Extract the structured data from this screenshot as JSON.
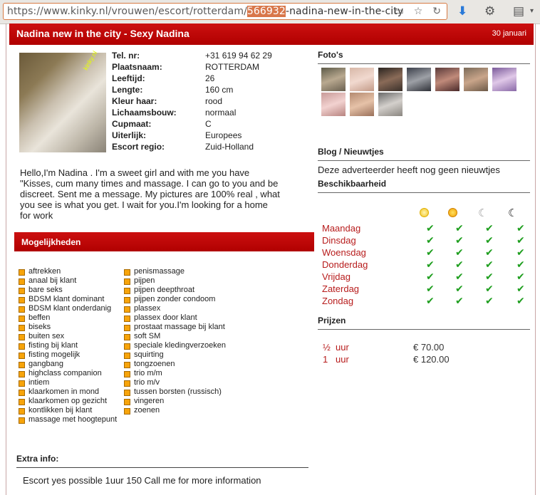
{
  "browser": {
    "url_prefix": "https://www.kinky.nl/vrouwen/escort/rotterdam/",
    "url_highlight": "566932",
    "url_suffix": "-nadina-new-in-the-city"
  },
  "header": {
    "title": "Nadina new in the city - Sexy Nadina",
    "date": "30 januari"
  },
  "profile": {
    "photo_logo": "kinky.nl",
    "fields": [
      {
        "label": "Tel. nr:",
        "value": "+31 619 94 62 29"
      },
      {
        "label": "Plaatsnaam:",
        "value": "ROTTERDAM"
      },
      {
        "label": "Leeftijd:",
        "value": "26"
      },
      {
        "label": "Lengte:",
        "value": "160 cm"
      },
      {
        "label": "Kleur haar:",
        "value": "rood"
      },
      {
        "label": "Lichaamsbouw:",
        "value": "normaal"
      },
      {
        "label": "Cupmaat:",
        "value": "C"
      },
      {
        "label": "Uiterlijk:",
        "value": "Europees"
      },
      {
        "label": "Escort regio:",
        "value": "Zuid-Holland"
      }
    ],
    "bio": "Hello,I'm Nadina . I'm a sweet girl and with me you have \"Kisses, cum many times and massage. I can go to you and be discreet. Sent me a message. My pictures are 100% real , what you see is what you get. I wait for you.I'm looking for a home for work"
  },
  "mogelijkheden": {
    "heading": "Mogelijkheden",
    "col1": [
      "aftrekken",
      "anaal bij klant",
      "bare seks",
      "BDSM klant dominant",
      "BDSM klant onderdanig",
      "beffen",
      "biseks",
      "buiten sex",
      "fisting bij klant",
      "fisting mogelijk",
      "gangbang",
      "highclass companion",
      "intiem",
      "klaarkomen in mond",
      "klaarkomen op gezicht",
      "kontlikken bij klant",
      "massage met hoogtepunt"
    ],
    "col2": [
      "penismassage",
      "pijpen",
      "pijpen deepthroat",
      "pijpen zonder condoom",
      "plassex",
      "plassex door klant",
      "prostaat massage bij klant",
      "soft SM",
      "speciale kledingverzoeken",
      "squirting",
      "tongzoenen",
      "trio m/m",
      "trio m/v",
      "tussen borsten (russisch)",
      "vingeren",
      "zoenen"
    ]
  },
  "extra": {
    "heading": "Extra info:",
    "text": "Escort yes possible 1uur 150 Call me for more information"
  },
  "sidebar": {
    "fotos_heading": "Foto's",
    "blog_heading": "Blog / Nieuwtjes",
    "blog_text": "Deze adverteerder heeft nog geen nieuwtjes",
    "availability_heading": "Beschikbaarheid",
    "days": [
      "Maandag",
      "Dinsdag",
      "Woensdag",
      "Donderdag",
      "Vrijdag",
      "Zaterdag",
      "Zondag"
    ],
    "prices_heading": "Prijzen",
    "prices": [
      {
        "duration": "½",
        "unit": "uur",
        "price": "€ 70.00"
      },
      {
        "duration": "1",
        "unit": "uur",
        "price": "€ 120.00"
      }
    ]
  },
  "colors": {
    "accent": "#c00000",
    "day_text": "#b71c1c",
    "check": "#1e9e1e"
  }
}
